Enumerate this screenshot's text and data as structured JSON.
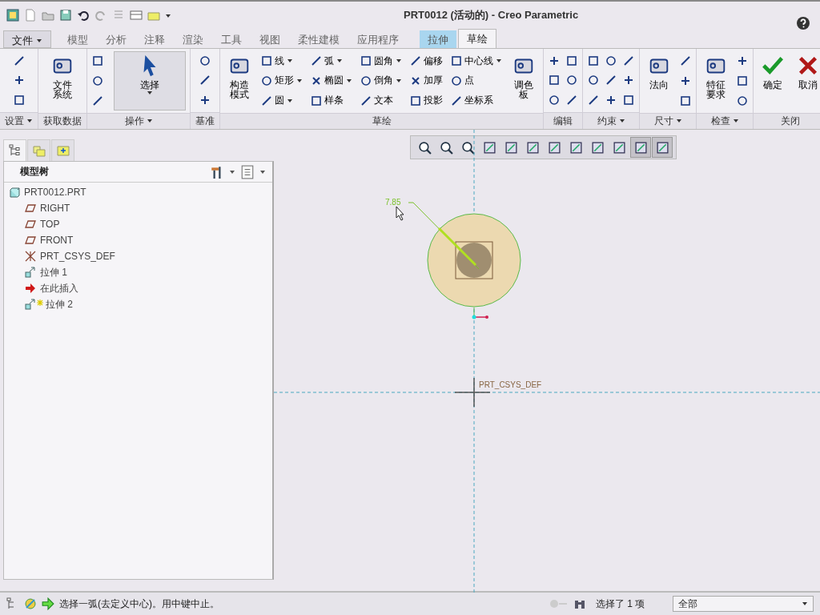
{
  "window": {
    "title": "PRT0012 (活动的) - Creo Parametric"
  },
  "menu_tabs": [
    {
      "label": "文件",
      "kind": "file",
      "selected": false
    },
    {
      "label": "模型",
      "kind": "tab",
      "selected": false
    },
    {
      "label": "分析",
      "kind": "tab",
      "selected": false
    },
    {
      "label": "注释",
      "kind": "tab",
      "selected": false
    },
    {
      "label": "渲染",
      "kind": "tab",
      "selected": false
    },
    {
      "label": "工具",
      "kind": "tab",
      "selected": false
    },
    {
      "label": "视图",
      "kind": "tab",
      "selected": false
    },
    {
      "label": "柔性建模",
      "kind": "tab",
      "selected": false
    },
    {
      "label": "应用程序",
      "kind": "tab",
      "selected": false
    },
    {
      "label": "拉伸",
      "kind": "context",
      "selected": false
    },
    {
      "label": "草绘",
      "kind": "tab",
      "selected": true
    }
  ],
  "ribbon": [
    {
      "label": "设置",
      "dropdown": true,
      "columns": [
        [
          {
            "kind": "icon"
          },
          {
            "kind": "icon"
          },
          {
            "kind": "icon"
          }
        ]
      ]
    },
    {
      "label": "获取数据",
      "dropdown": false,
      "columns": [
        [
          {
            "kind": "large",
            "label": "文件系统",
            "dropdown": false,
            "selected": false
          }
        ]
      ]
    },
    {
      "label": "操作",
      "dropdown": true,
      "columns": [
        [
          {
            "kind": "icon"
          },
          {
            "kind": "icon"
          },
          {
            "kind": "icon"
          }
        ],
        [
          {
            "kind": "large",
            "label": "选择",
            "dropdown": true,
            "selected": true
          }
        ]
      ]
    },
    {
      "label": "基准",
      "dropdown": false,
      "columns": [
        [
          {
            "kind": "icon"
          },
          {
            "kind": "icon"
          },
          {
            "kind": "icon"
          }
        ]
      ]
    },
    {
      "label": "草绘",
      "dropdown": false,
      "columns": [
        [
          {
            "kind": "large",
            "label": "构造模式",
            "dropdown": false,
            "selected": false
          }
        ],
        [
          {
            "kind": "small",
            "label": "线",
            "dropdown": true
          },
          {
            "kind": "small",
            "label": "矩形",
            "dropdown": true
          },
          {
            "kind": "small",
            "label": "圆",
            "dropdown": true
          }
        ],
        [
          {
            "kind": "small",
            "label": "弧",
            "dropdown": true
          },
          {
            "kind": "small",
            "label": "椭圆",
            "dropdown": true
          },
          {
            "kind": "small",
            "label": "样条",
            "dropdown": false
          }
        ],
        [
          {
            "kind": "small",
            "label": "圆角",
            "dropdown": true
          },
          {
            "kind": "small",
            "label": "倒角",
            "dropdown": true
          },
          {
            "kind": "small",
            "label": "文本",
            "dropdown": false
          }
        ],
        [
          {
            "kind": "small",
            "label": "偏移",
            "dropdown": false
          },
          {
            "kind": "small",
            "label": "加厚",
            "dropdown": false
          },
          {
            "kind": "small",
            "label": "投影",
            "dropdown": false
          }
        ],
        [
          {
            "kind": "small",
            "label": "中心线",
            "dropdown": true
          },
          {
            "kind": "small",
            "label": "点",
            "dropdown": false
          },
          {
            "kind": "small",
            "label": "坐标系",
            "dropdown": false
          }
        ],
        [
          {
            "kind": "large",
            "label": "调色板",
            "dropdown": false,
            "selected": false
          }
        ]
      ]
    },
    {
      "label": "编辑",
      "dropdown": false,
      "columns": [
        [
          {
            "kind": "icon"
          },
          {
            "kind": "icon"
          },
          {
            "kind": "icon"
          }
        ],
        [
          {
            "kind": "icon"
          },
          {
            "kind": "icon"
          },
          {
            "kind": "icon"
          }
        ]
      ]
    },
    {
      "label": "约束",
      "dropdown": true,
      "columns": [
        [
          {
            "kind": "icon"
          },
          {
            "kind": "icon"
          },
          {
            "kind": "icon"
          }
        ],
        [
          {
            "kind": "icon"
          },
          {
            "kind": "icon"
          },
          {
            "kind": "icon"
          }
        ],
        [
          {
            "kind": "icon"
          },
          {
            "kind": "icon"
          },
          {
            "kind": "icon"
          }
        ]
      ]
    },
    {
      "label": "尺寸",
      "dropdown": true,
      "columns": [
        [
          {
            "kind": "large",
            "label": "法向",
            "dropdown": false,
            "selected": false
          }
        ],
        [
          {
            "kind": "icon"
          },
          {
            "kind": "icon"
          },
          {
            "kind": "icon"
          }
        ]
      ]
    },
    {
      "label": "检查",
      "dropdown": true,
      "columns": [
        [
          {
            "kind": "large",
            "label": "特征要求",
            "dropdown": false,
            "selected": false
          }
        ],
        [
          {
            "kind": "icon"
          },
          {
            "kind": "icon"
          },
          {
            "kind": "icon"
          }
        ]
      ]
    },
    {
      "label": "关闭",
      "dropdown": false,
      "columns": [
        [
          {
            "kind": "ok",
            "label": "确定",
            "dropdown": false,
            "selected": false
          }
        ],
        [
          {
            "kind": "cancel",
            "label": "取消",
            "dropdown": false,
            "selected": false
          }
        ]
      ]
    }
  ],
  "navigator_tabs": [
    {
      "selected": true
    },
    {
      "selected": false
    },
    {
      "selected": false
    }
  ],
  "model_tree": {
    "title": "模型树",
    "root": {
      "label": "PRT0012.PRT",
      "kind": "part",
      "children": [
        {
          "label": "RIGHT",
          "kind": "plane",
          "new": false
        },
        {
          "label": "TOP",
          "kind": "plane",
          "new": false
        },
        {
          "label": "FRONT",
          "kind": "plane",
          "new": false
        },
        {
          "label": "PRT_CSYS_DEF",
          "kind": "csys",
          "new": false
        },
        {
          "label": "拉伸 1",
          "kind": "extrude",
          "new": false
        },
        {
          "label": "在此插入",
          "kind": "insert",
          "new": false
        },
        {
          "label": "拉伸 2",
          "kind": "extrude",
          "new": true
        }
      ]
    }
  },
  "graphics_toolbar": [
    {
      "pressed": false
    },
    {
      "pressed": false
    },
    {
      "pressed": false
    },
    {
      "pressed": false
    },
    {
      "pressed": false
    },
    {
      "pressed": false
    },
    {
      "pressed": false
    },
    {
      "pressed": false
    },
    {
      "pressed": false
    },
    {
      "pressed": false
    },
    {
      "pressed": true
    },
    {
      "pressed": true
    }
  ],
  "canvas": {
    "dimension": "7.85",
    "csys_label": "PRT_CSYS_DEF"
  },
  "status_bar": {
    "message": "选择一弧(去定义中心)。用中键中止。",
    "selection": "选择了 1 项",
    "filter": "全部"
  }
}
